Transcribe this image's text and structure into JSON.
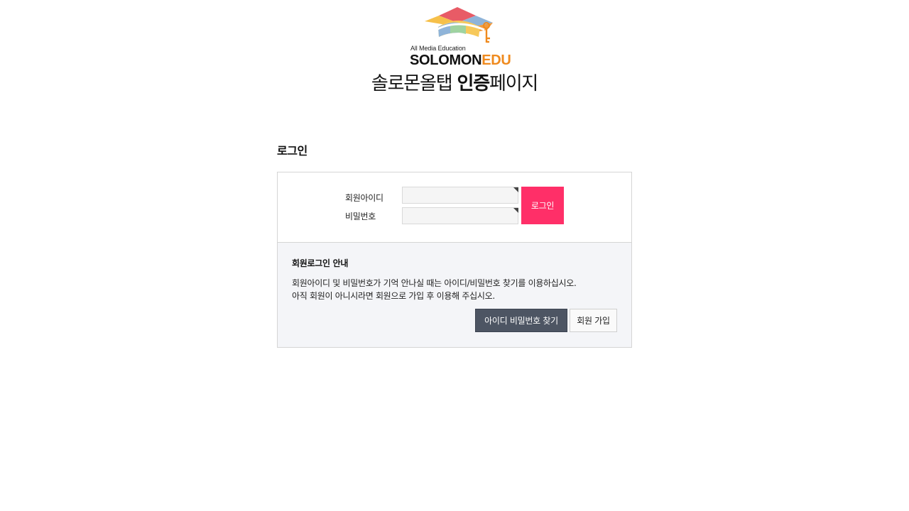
{
  "header": {
    "logo_tagline": "All Media Education",
    "logo_brand_part1": "SOLOMON",
    "logo_brand_part2": "EDU",
    "title_regular": "솔로몬올탭 ",
    "title_bold": "인증",
    "title_suffix": "페이지",
    "brand_colors": {
      "primary": "#111111",
      "accent": "#ef8a1e"
    }
  },
  "login": {
    "section_title": "로그인",
    "id_label": "회원아이디",
    "id_value": "",
    "password_label": "비밀번호",
    "password_value": "",
    "submit_label": "로그인",
    "submit_color": "#ff2f68"
  },
  "info": {
    "title": "회원로그인 안내",
    "line1": "회원아이디 및 비밀번호가 기억 안나실 때는 아이디/비밀번호 찾기를 이용하십시오.",
    "line2": "아직 회원이 아니시라면 회원으로 가입 후 이용해 주십시오.",
    "find_button_label": "아이디 비밀번호 찾기",
    "join_button_label": "회원 가입"
  }
}
